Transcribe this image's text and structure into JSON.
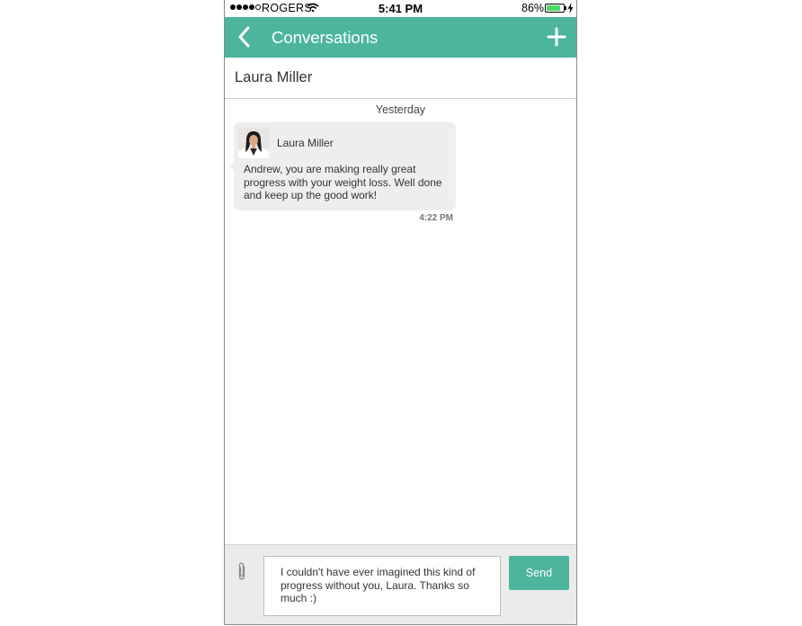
{
  "status_bar": {
    "carrier": "ROGERS",
    "time": "5:41 PM",
    "battery": "86%",
    "battery_level": 0.86,
    "signal_bars": 4,
    "icons": [
      "wifi-icon",
      "battery-icon",
      "charging-icon"
    ]
  },
  "nav": {
    "title": "Conversations",
    "back_icon": "chevron-left-icon",
    "add_icon": "plus-icon"
  },
  "conversation": {
    "contact_name": "Laura Miller",
    "date_label": "Yesterday",
    "messages": [
      {
        "sender": "Laura Miller",
        "text": "Andrew, you are making really great progress with your weight loss. Well done and keep up the good work!",
        "time": "4:22 PM"
      }
    ]
  },
  "composer": {
    "attach_icon": "paperclip-icon",
    "draft_text": "I couldn't have ever imagined this kind of progress without you, Laura. Thanks so much :)",
    "send_label": "Send"
  },
  "colors": {
    "accent": "#4db59e",
    "bubble": "#eeeeee",
    "composer_bg": "#ebebeb"
  }
}
